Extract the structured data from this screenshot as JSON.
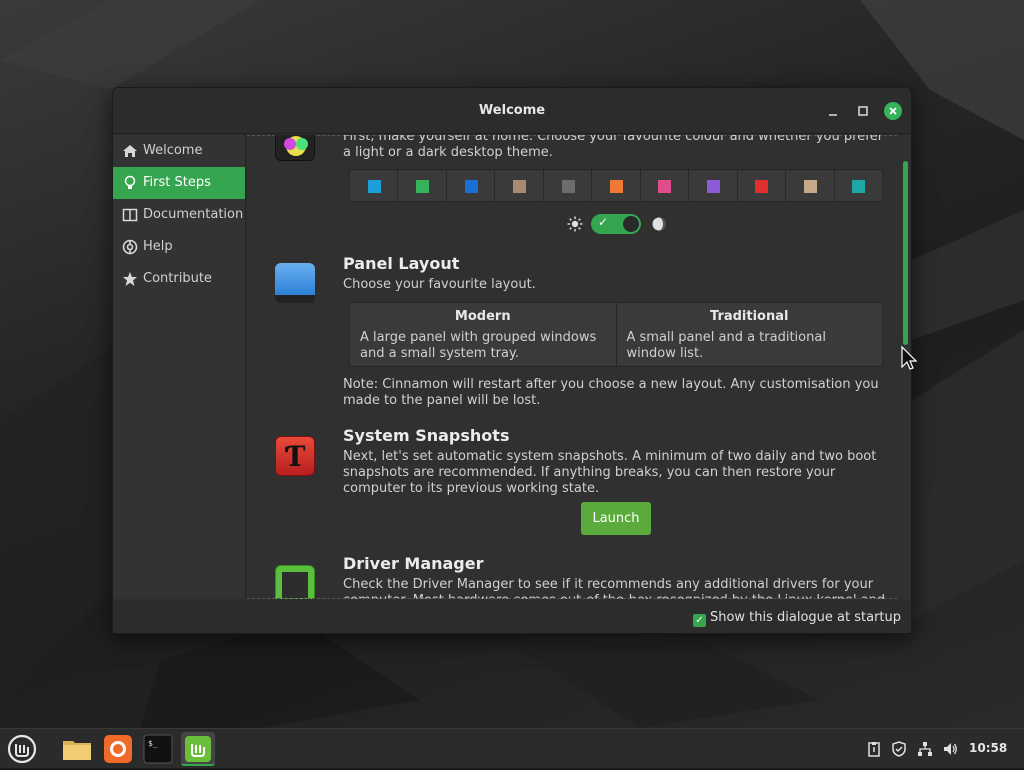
{
  "window": {
    "title": "Welcome"
  },
  "sidebar": {
    "items": [
      {
        "label": "Welcome",
        "icon": "home-icon"
      },
      {
        "label": "First Steps",
        "icon": "lightbulb-icon",
        "active": true
      },
      {
        "label": "Documentation",
        "icon": "book-icon"
      },
      {
        "label": "Help",
        "icon": "lifebuoy-icon"
      },
      {
        "label": "Contribute",
        "icon": "star-icon"
      }
    ]
  },
  "content": {
    "theme": {
      "text": "First, make yourself at home. Choose your favourite colour and whether you prefer a light or a dark desktop theme.",
      "swatches": [
        "#1c9fd8",
        "#35b25a",
        "#1a6fd6",
        "#a88a72",
        "#6d6d6d",
        "#f07a35",
        "#e04c8c",
        "#8e5bd8",
        "#e02f2f",
        "#c7a98a",
        "#1fa6a6"
      ],
      "dark_mode": true
    },
    "panel_layout": {
      "title": "Panel Layout",
      "text": "Choose your favourite layout.",
      "options": [
        {
          "title": "Modern",
          "desc": "A large panel with grouped windows and a small system tray."
        },
        {
          "title": "Traditional",
          "desc": "A small panel and a traditional window list."
        }
      ],
      "note": "Note: Cinnamon will restart after you choose a new layout. Any customisation you made to the panel will be lost."
    },
    "snapshots": {
      "title": "System Snapshots",
      "text": "Next, let's set automatic system snapshots. A minimum of two daily and two boot snapshots are recommended. If anything breaks, you can then restore your computer to its previous working state.",
      "button": "Launch"
    },
    "drivers": {
      "title": "Driver Manager",
      "text": "Check the Driver Manager to see if it recommends any additional drivers for your computer. Most hardware comes out-of-the-box recognized by the Linux kernel and works automatically."
    }
  },
  "footer": {
    "startup_label": "Show this dialogue at startup",
    "startup_checked": true
  },
  "taskbar": {
    "apps": [
      "mint-menu-icon",
      "files-icon",
      "firefox-icon",
      "terminal-icon",
      "welcome-icon"
    ],
    "tray": [
      "clipboard-icon",
      "shield-icon",
      "network-icon",
      "volume-icon"
    ],
    "clock": "10:58"
  },
  "colors": {
    "accent": "#35a64f"
  }
}
